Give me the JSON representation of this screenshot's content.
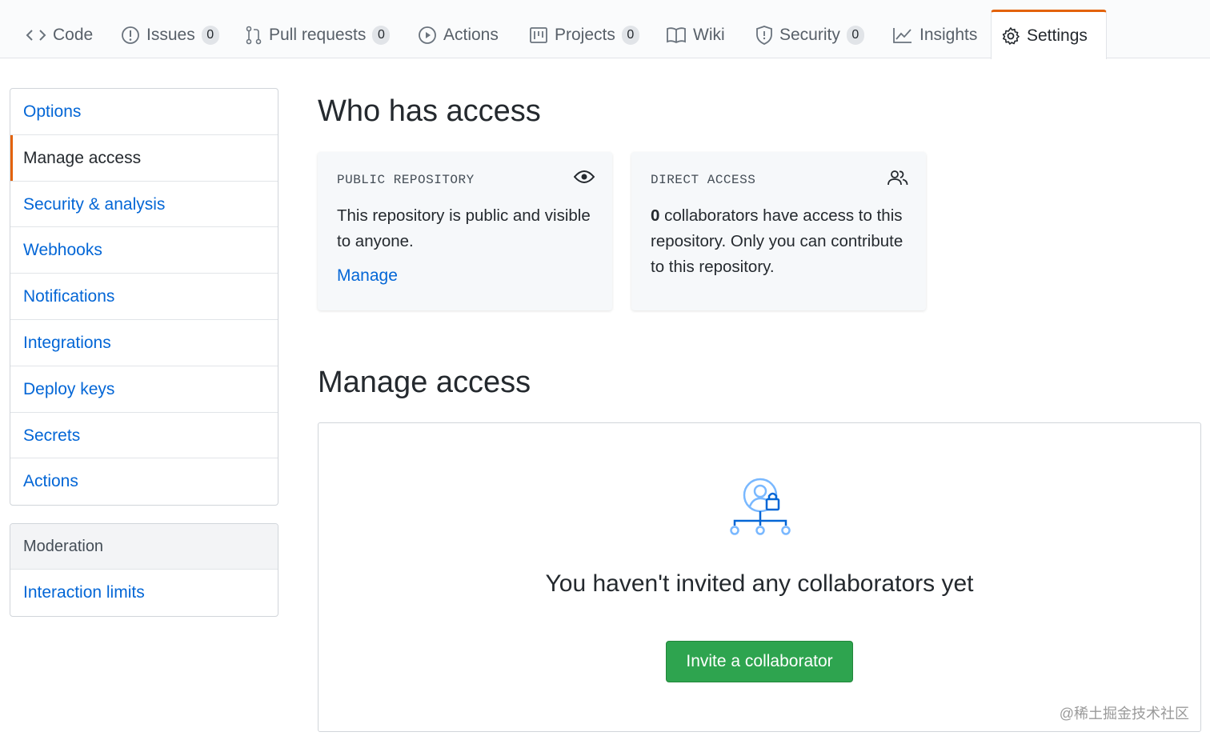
{
  "tabs": [
    {
      "label": "Code",
      "icon": "code-icon"
    },
    {
      "label": "Issues",
      "icon": "issue-icon",
      "count": "0"
    },
    {
      "label": "Pull requests",
      "icon": "pull-request-icon",
      "count": "0"
    },
    {
      "label": "Actions",
      "icon": "play-icon"
    },
    {
      "label": "Projects",
      "icon": "project-icon",
      "count": "0"
    },
    {
      "label": "Wiki",
      "icon": "book-icon"
    },
    {
      "label": "Security",
      "icon": "shield-icon",
      "count": "0"
    },
    {
      "label": "Insights",
      "icon": "graph-icon"
    },
    {
      "label": "Settings",
      "icon": "gear-icon",
      "selected": true
    }
  ],
  "sidebar": {
    "items": [
      {
        "label": "Options"
      },
      {
        "label": "Manage access",
        "active": true
      },
      {
        "label": "Security & analysis"
      },
      {
        "label": "Webhooks"
      },
      {
        "label": "Notifications"
      },
      {
        "label": "Integrations"
      },
      {
        "label": "Deploy keys"
      },
      {
        "label": "Secrets"
      },
      {
        "label": "Actions"
      }
    ],
    "moderation": {
      "heading": "Moderation",
      "items": [
        {
          "label": "Interaction limits"
        }
      ]
    }
  },
  "who_has_access": {
    "title": "Who has access",
    "public_card": {
      "label": "PUBLIC REPOSITORY",
      "icon": "eye-icon",
      "text": "This repository is public and visible to anyone.",
      "link": "Manage"
    },
    "direct_card": {
      "label": "DIRECT ACCESS",
      "icon": "people-icon",
      "count": "0",
      "text": " collaborators have access to this repository. Only you can contribute to this repository."
    }
  },
  "manage_access": {
    "title": "Manage access",
    "empty_heading": "You haven't invited any collaborators yet",
    "invite_button": "Invite a collaborator"
  },
  "watermark": "@稀土掘金技术社区",
  "colors": {
    "accent": "#e36209",
    "link": "#0366d6",
    "primary_button": "#2ea44f"
  }
}
